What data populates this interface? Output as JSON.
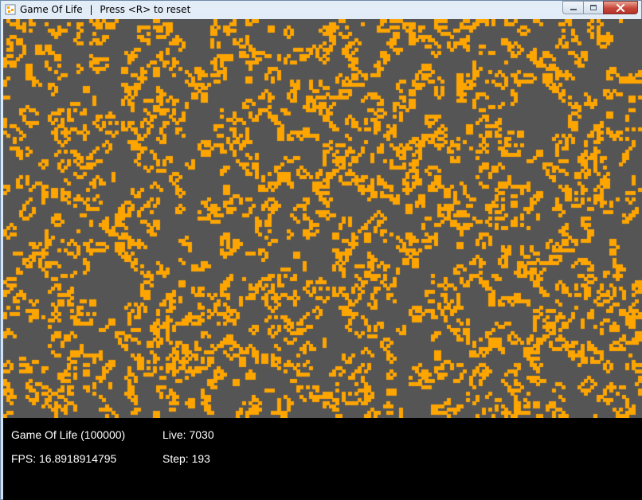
{
  "window": {
    "title": "Game Of Life",
    "separator": "|",
    "subtitle": "Press <R> to reset",
    "icons": [
      "app-icon",
      "minimize-icon",
      "maximize-icon",
      "close-icon"
    ]
  },
  "board": {
    "background_color": "#555555",
    "cell_color": "#ffa500",
    "columns": 200,
    "rows": 125
  },
  "hud": {
    "game_label": "Game Of Life (100000)",
    "fps_label": "FPS: 16.8918914795",
    "live_label": "Live: 7030",
    "step_label": "Step: 193",
    "fps": 16.8918914795,
    "live": 7030,
    "step": 193
  }
}
